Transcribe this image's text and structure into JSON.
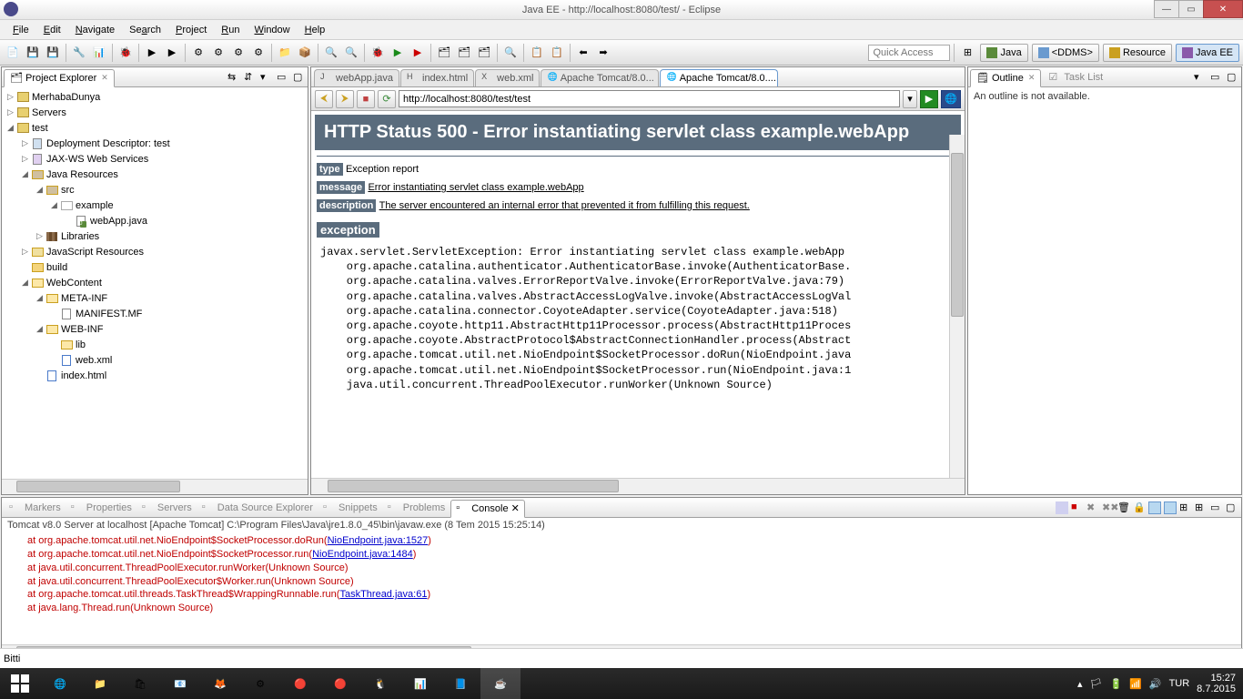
{
  "window": {
    "title": "Java EE - http://localhost:8080/test/ - Eclipse"
  },
  "menubar": [
    "File",
    "Edit",
    "Navigate",
    "Search",
    "Project",
    "Run",
    "Window",
    "Help"
  ],
  "quick_access_placeholder": "Quick Access",
  "perspectives": [
    {
      "label": "Java"
    },
    {
      "label": "<DDMS>"
    },
    {
      "label": "Resource"
    },
    {
      "label": "Java EE"
    }
  ],
  "project_explorer": {
    "title": "Project Explorer",
    "tree": [
      {
        "d": 0,
        "a": "r",
        "i": "proj",
        "l": "MerhabaDunya"
      },
      {
        "d": 0,
        "a": "r",
        "i": "proj",
        "l": "Servers"
      },
      {
        "d": 0,
        "a": "d",
        "i": "proj",
        "l": "test"
      },
      {
        "d": 1,
        "a": "r",
        "i": "dd",
        "l": "Deployment Descriptor: test"
      },
      {
        "d": 1,
        "a": "r",
        "i": "jax",
        "l": "JAX-WS Web Services"
      },
      {
        "d": 1,
        "a": "d",
        "i": "jres",
        "l": "Java Resources"
      },
      {
        "d": 2,
        "a": "d",
        "i": "src",
        "l": "src"
      },
      {
        "d": 3,
        "a": "d",
        "i": "pkg",
        "l": "example"
      },
      {
        "d": 4,
        "a": "",
        "i": "java",
        "l": "webApp.java"
      },
      {
        "d": 2,
        "a": "r",
        "i": "lib",
        "l": "Libraries"
      },
      {
        "d": 1,
        "a": "r",
        "i": "js",
        "l": "JavaScript Resources"
      },
      {
        "d": 1,
        "a": "",
        "i": "folder",
        "l": "build"
      },
      {
        "d": 1,
        "a": "d",
        "i": "folder-open",
        "l": "WebContent"
      },
      {
        "d": 2,
        "a": "d",
        "i": "folder-open",
        "l": "META-INF"
      },
      {
        "d": 3,
        "a": "",
        "i": "file",
        "l": "MANIFEST.MF"
      },
      {
        "d": 2,
        "a": "d",
        "i": "folder-open",
        "l": "WEB-INF"
      },
      {
        "d": 3,
        "a": "",
        "i": "folder-open",
        "l": "lib"
      },
      {
        "d": 3,
        "a": "",
        "i": "xml",
        "l": "web.xml"
      },
      {
        "d": 2,
        "a": "",
        "i": "html",
        "l": "index.html"
      }
    ]
  },
  "editor_tabs": [
    {
      "label": "webApp.java",
      "icon": "java"
    },
    {
      "label": "index.html",
      "icon": "html"
    },
    {
      "label": "web.xml",
      "icon": "xml"
    },
    {
      "label": "Apache Tomcat/8.0...",
      "icon": "globe"
    },
    {
      "label": "Apache Tomcat/8.0....",
      "icon": "globe",
      "active": true
    }
  ],
  "browser": {
    "url": "http://localhost:8080/test/test",
    "title": "HTTP Status 500 - Error instantiating servlet class example.webApp",
    "type_label": "type",
    "type_text": "Exception report",
    "message_label": "message",
    "message_text": "Error instantiating servlet class example.webApp",
    "description_label": "description",
    "description_text": "The server encountered an internal error that prevented it from fulfilling this request.",
    "exception_label": "exception",
    "stacktrace": "javax.servlet.ServletException: Error instantiating servlet class example.webApp\n    org.apache.catalina.authenticator.AuthenticatorBase.invoke(AuthenticatorBase.\n    org.apache.catalina.valves.ErrorReportValve.invoke(ErrorReportValve.java:79)\n    org.apache.catalina.valves.AbstractAccessLogValve.invoke(AbstractAccessLogVal\n    org.apache.catalina.connector.CoyoteAdapter.service(CoyoteAdapter.java:518)\n    org.apache.coyote.http11.AbstractHttp11Processor.process(AbstractHttp11Proces\n    org.apache.coyote.AbstractProtocol$AbstractConnectionHandler.process(Abstract\n    org.apache.tomcat.util.net.NioEndpoint$SocketProcessor.doRun(NioEndpoint.java\n    org.apache.tomcat.util.net.NioEndpoint$SocketProcessor.run(NioEndpoint.java:1\n    java.util.concurrent.ThreadPoolExecutor.runWorker(Unknown Source)"
  },
  "outline": {
    "title": "Outline",
    "task_list": "Task List",
    "message": "An outline is not available."
  },
  "console_view": {
    "tabs": [
      "Markers",
      "Properties",
      "Servers",
      "Data Source Explorer",
      "Snippets",
      "Problems",
      "Console"
    ],
    "active_tab": "Console",
    "header": "Tomcat v8.0 Server at localhost [Apache Tomcat] C:\\Program Files\\Java\\jre1.8.0_45\\bin\\javaw.exe (8 Tem 2015 15:25:14)",
    "lines": [
      {
        "at": "at ",
        "body": "org.apache.tomcat.util.net.NioEndpoint$SocketProcessor.doRun(",
        "link": "NioEndpoint.java:1527",
        "tail": ")"
      },
      {
        "at": "at ",
        "body": "org.apache.tomcat.util.net.NioEndpoint$SocketProcessor.run(",
        "link": "NioEndpoint.java:1484",
        "tail": ")"
      },
      {
        "at": "at ",
        "body": "java.util.concurrent.ThreadPoolExecutor.runWorker(Unknown Source)",
        "link": "",
        "tail": ""
      },
      {
        "at": "at ",
        "body": "java.util.concurrent.ThreadPoolExecutor$Worker.run(Unknown Source)",
        "link": "",
        "tail": ""
      },
      {
        "at": "at ",
        "body": "org.apache.tomcat.util.threads.TaskThread$WrappingRunnable.run(",
        "link": "TaskThread.java:61",
        "tail": ")"
      },
      {
        "at": "at ",
        "body": "java.lang.Thread.run(Unknown Source)",
        "link": "",
        "tail": ""
      }
    ]
  },
  "status": {
    "text": "Bitti"
  },
  "tray": {
    "lang": "TUR",
    "time": "15:27",
    "date": "8.7.2015"
  }
}
